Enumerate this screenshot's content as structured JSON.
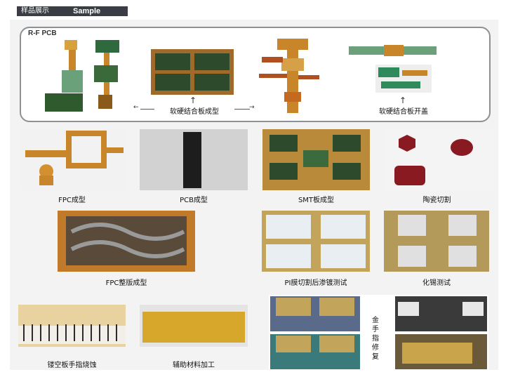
{
  "header": {
    "cn": "样品展示",
    "en": "Sample"
  },
  "rf_pcb": {
    "title": "R-F PCB",
    "label_forming": "软硬结合板成型",
    "label_open": "软硬结合板开盖"
  },
  "captions": {
    "fpc": "FPC成型",
    "pcb": "PCB成型",
    "smt": "SMT板成型",
    "ceramic": "陶瓷切割",
    "fpc_panel": "FPC整版成型",
    "pi": "PI膜切割后渗镀测试",
    "tin": "化锡测试",
    "hollow": "镂空板手指烧蚀",
    "aux": "辅助材料加工",
    "gold": "金手指修复"
  },
  "colors": {
    "header": "#3a3e44",
    "fpc": "#c9852a",
    "pcb_green": "#2e5a2e",
    "ceramic": "#8a1a22"
  }
}
